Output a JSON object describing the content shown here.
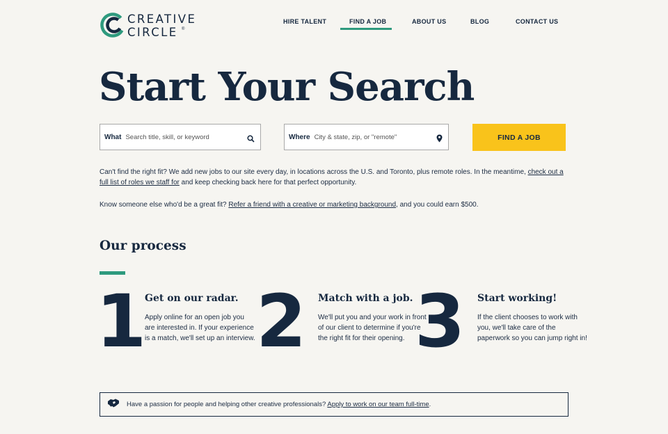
{
  "brand": {
    "line1": "CREATIVE",
    "line2": "CIRCLE",
    "reg": "®",
    "accent_color": "#2e9a7e",
    "navy_color": "#16283f",
    "cta_color": "#f9c31b"
  },
  "nav": {
    "items": [
      "HIRE TALENT",
      "FIND A JOB",
      "ABOUT US",
      "BLOG",
      "CONTACT US"
    ],
    "active": "FIND A JOB"
  },
  "hero": {
    "title": "Start Your Search"
  },
  "search": {
    "what_label": "What",
    "what_placeholder": "Search title, skill, or keyword",
    "what_icon": "search-icon",
    "where_label": "Where",
    "where_placeholder": "City & state, zip, or \"remote\"",
    "where_icon": "location-pin-icon",
    "button_label": "FIND A JOB"
  },
  "info": {
    "p1_text": "Can't find the right fit? We add new jobs to our site every day, in locations across the U.S. and Toronto, plus remote roles. In the meantime, ",
    "p1_link": "check out a full list of roles we staff for",
    "p1_after": " and keep checking back here for that perfect opportunity.",
    "p2_text": "Know someone else who'd be a great fit? ",
    "p2_link": "Refer a friend with a creative or marketing background",
    "p2_after": ", and you could earn $500."
  },
  "process": {
    "title": "Our process",
    "steps": [
      {
        "number": "1",
        "title": "Get on our radar.",
        "text": "Apply online for an open job you are interested in. If your experience is a match, we'll set up an interview."
      },
      {
        "number": "2",
        "title": "Match with a job.",
        "text": "We'll put you and your work in front of our client to determine if you're the right fit for their opening."
      },
      {
        "number": "3",
        "title": "Start working!",
        "text": "If the client chooses to work with you, we'll take care of the paperwork so you can jump right in!"
      }
    ]
  },
  "banner": {
    "icon": "handshake-icon",
    "text": "Have a passion for people and helping other creative professionals? ",
    "link": "Apply to work on our team full-time",
    "after": "."
  }
}
